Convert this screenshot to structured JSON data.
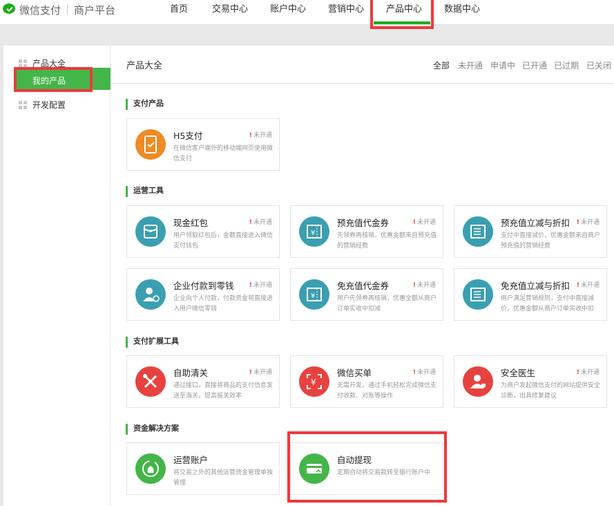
{
  "header": {
    "brand": "微信支付",
    "sub_brand": "商户平台",
    "nav": [
      "首页",
      "交易中心",
      "账户中心",
      "营销中心",
      "产品中心",
      "数据中心"
    ]
  },
  "sidebar": {
    "items": [
      {
        "label": "产品大全"
      },
      {
        "label": "我的产品"
      },
      {
        "label": "开发配置"
      }
    ]
  },
  "main": {
    "title": "产品大全",
    "filters": [
      "全部",
      "未开通",
      "申请中",
      "已开通",
      "已过期",
      "已关闭"
    ],
    "status_mark": "!",
    "sections": [
      {
        "title": "支付产品",
        "cards": [
          {
            "name": "H5支付",
            "status": "未开通",
            "desc": "在微信客户端外的移动端网页使用微信支付",
            "icon": "phone-check-icon",
            "color": "#f08a24"
          }
        ]
      },
      {
        "title": "运营工具",
        "cards": [
          {
            "name": "现金红包",
            "status": "未开通",
            "desc": "用户领取红包后，金额直接进入微信支付钱包",
            "icon": "red-packet-icon",
            "color": "#3a9fb0"
          },
          {
            "name": "预充值代金券",
            "status": "未开通",
            "desc": "先领券再核销，优惠金额来自预充值的营销经费",
            "icon": "yen-coupon-icon",
            "color": "#3a9fb0"
          },
          {
            "name": "预充值立减与折扣",
            "status": "未开通",
            "desc": "支付中直接减价，优惠金额来自商户预充值的营销经费",
            "icon": "discount-coupon-icon",
            "color": "#3a9fb0"
          },
          {
            "name": "企业付款到零钱",
            "status": "未开通",
            "desc": "企业向个人付款，付款资金将直接进入用户微信零钱",
            "icon": "user-pay-icon",
            "color": "#3a9fb0"
          },
          {
            "name": "免充值代金券",
            "status": "未开通",
            "desc": "用户先领券再核销，优惠全额从商户订单实收中扣减",
            "icon": "yen-coupon-icon",
            "color": "#3a9fb0"
          },
          {
            "name": "免充值立减与折扣",
            "status": "未开通",
            "desc": "用户满足营销规则，支付中直接减价，优惠金额从商户订单实收中扣",
            "icon": "discount-coupon-icon",
            "color": "#3a9fb0"
          }
        ]
      },
      {
        "title": "支付扩展工具",
        "cards": [
          {
            "name": "自助清关",
            "status": "未开通",
            "desc": "通过接口，直接将商品的支付信息发送至海关，提高报关效率",
            "icon": "tools-icon",
            "color": "#e64340"
          },
          {
            "name": "微信买单",
            "status": "未开通",
            "desc": "无需开发，通过手机轻松完成微信支付收款、对账等操作",
            "icon": "scan-yen-icon",
            "color": "#e64340"
          },
          {
            "name": "安全医生",
            "status": "未开通",
            "desc": "为商户发起微信支付的网站提供安全诊断，出具修复建议",
            "icon": "doctor-icon",
            "color": "#e64340"
          }
        ]
      },
      {
        "title": "资金解决方案",
        "cards": [
          {
            "name": "运营账户",
            "status": "",
            "desc": "将交易之外的其他运营资金管理单独管理",
            "icon": "money-bag-icon",
            "color": "#44b549"
          },
          {
            "name": "自动提现",
            "status": "",
            "desc": "定期自动将交易款转至银行账户中",
            "icon": "card-withdraw-icon",
            "color": "#44b549"
          }
        ]
      }
    ]
  }
}
